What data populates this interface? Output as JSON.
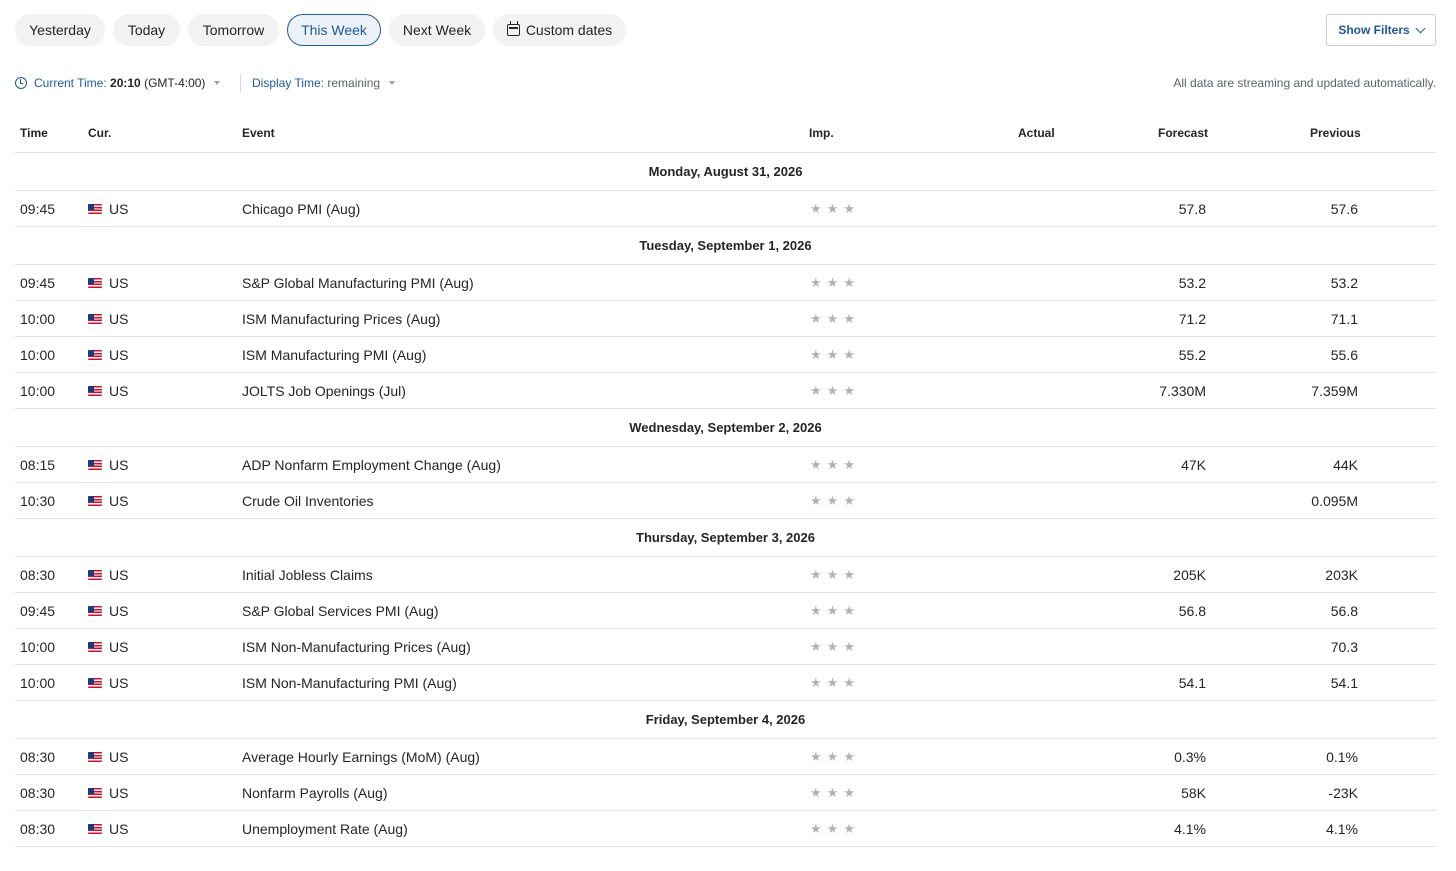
{
  "filters": {
    "tabs": [
      {
        "label": "Yesterday",
        "active": false
      },
      {
        "label": "Today",
        "active": false
      },
      {
        "label": "Tomorrow",
        "active": false
      },
      {
        "label": "This Week",
        "active": true
      },
      {
        "label": "Next Week",
        "active": false
      },
      {
        "label": "Custom dates",
        "active": false,
        "icon": "calendar-icon"
      }
    ],
    "show_filters_label": "Show Filters"
  },
  "timebar": {
    "current_time_label": "Current Time:",
    "current_time_value": "20:10",
    "timezone": "(GMT-4:00)",
    "display_time_label": "Display Time:",
    "display_time_value": "remaining",
    "streaming_note": "All data are streaming and updated automatically."
  },
  "colors": {
    "accent": "#1e5a96",
    "pill_bg": "#f0f2f4",
    "row_border": "#e0e4e8",
    "star": "#aeb3ba"
  },
  "table": {
    "headers": {
      "time": "Time",
      "currency": "Cur.",
      "event": "Event",
      "importance": "Imp.",
      "actual": "Actual",
      "forecast": "Forecast",
      "previous": "Previous"
    },
    "days": [
      {
        "date": "Monday, August 31, 2026",
        "events": [
          {
            "time": "09:45",
            "currency": "US",
            "event": "Chicago PMI  (Aug)",
            "importance": 3,
            "actual": "",
            "forecast": "57.8",
            "previous": "57.6"
          }
        ]
      },
      {
        "date": "Tuesday, September 1, 2026",
        "events": [
          {
            "time": "09:45",
            "currency": "US",
            "event": "S&P Global Manufacturing PMI  (Aug)",
            "importance": 3,
            "actual": "",
            "forecast": "53.2",
            "previous": "53.2"
          },
          {
            "time": "10:00",
            "currency": "US",
            "event": "ISM Manufacturing Prices  (Aug)",
            "importance": 3,
            "actual": "",
            "forecast": "71.2",
            "previous": "71.1"
          },
          {
            "time": "10:00",
            "currency": "US",
            "event": "ISM Manufacturing PMI  (Aug)",
            "importance": 3,
            "actual": "",
            "forecast": "55.2",
            "previous": "55.6"
          },
          {
            "time": "10:00",
            "currency": "US",
            "event": "JOLTS Job Openings  (Jul)",
            "importance": 3,
            "actual": "",
            "forecast": "7.330M",
            "previous": "7.359M"
          }
        ]
      },
      {
        "date": "Wednesday, September 2, 2026",
        "events": [
          {
            "time": "08:15",
            "currency": "US",
            "event": "ADP Nonfarm Employment Change  (Aug)",
            "importance": 3,
            "actual": "",
            "forecast": "47K",
            "previous": "44K"
          },
          {
            "time": "10:30",
            "currency": "US",
            "event": "Crude Oil Inventories",
            "importance": 3,
            "actual": "",
            "forecast": "",
            "previous": "0.095M"
          }
        ]
      },
      {
        "date": "Thursday, September 3, 2026",
        "events": [
          {
            "time": "08:30",
            "currency": "US",
            "event": "Initial Jobless Claims",
            "importance": 3,
            "actual": "",
            "forecast": "205K",
            "previous": "203K"
          },
          {
            "time": "09:45",
            "currency": "US",
            "event": "S&P Global Services PMI  (Aug)",
            "importance": 3,
            "actual": "",
            "forecast": "56.8",
            "previous": "56.8"
          },
          {
            "time": "10:00",
            "currency": "US",
            "event": "ISM Non-Manufacturing Prices  (Aug)",
            "importance": 3,
            "actual": "",
            "forecast": "",
            "previous": "70.3"
          },
          {
            "time": "10:00",
            "currency": "US",
            "event": "ISM Non-Manufacturing PMI  (Aug)",
            "importance": 3,
            "actual": "",
            "forecast": "54.1",
            "previous": "54.1"
          }
        ]
      },
      {
        "date": "Friday, September 4, 2026",
        "events": [
          {
            "time": "08:30",
            "currency": "US",
            "event": "Average Hourly Earnings (MoM) (Aug)",
            "importance": 3,
            "actual": "",
            "forecast": "0.3%",
            "previous": "0.1%"
          },
          {
            "time": "08:30",
            "currency": "US",
            "event": "Nonfarm Payrolls  (Aug)",
            "importance": 3,
            "actual": "",
            "forecast": "58K",
            "previous": "-23K"
          },
          {
            "time": "08:30",
            "currency": "US",
            "event": "Unemployment Rate  (Aug)",
            "importance": 3,
            "actual": "",
            "forecast": "4.1%",
            "previous": "4.1%"
          }
        ]
      }
    ]
  }
}
